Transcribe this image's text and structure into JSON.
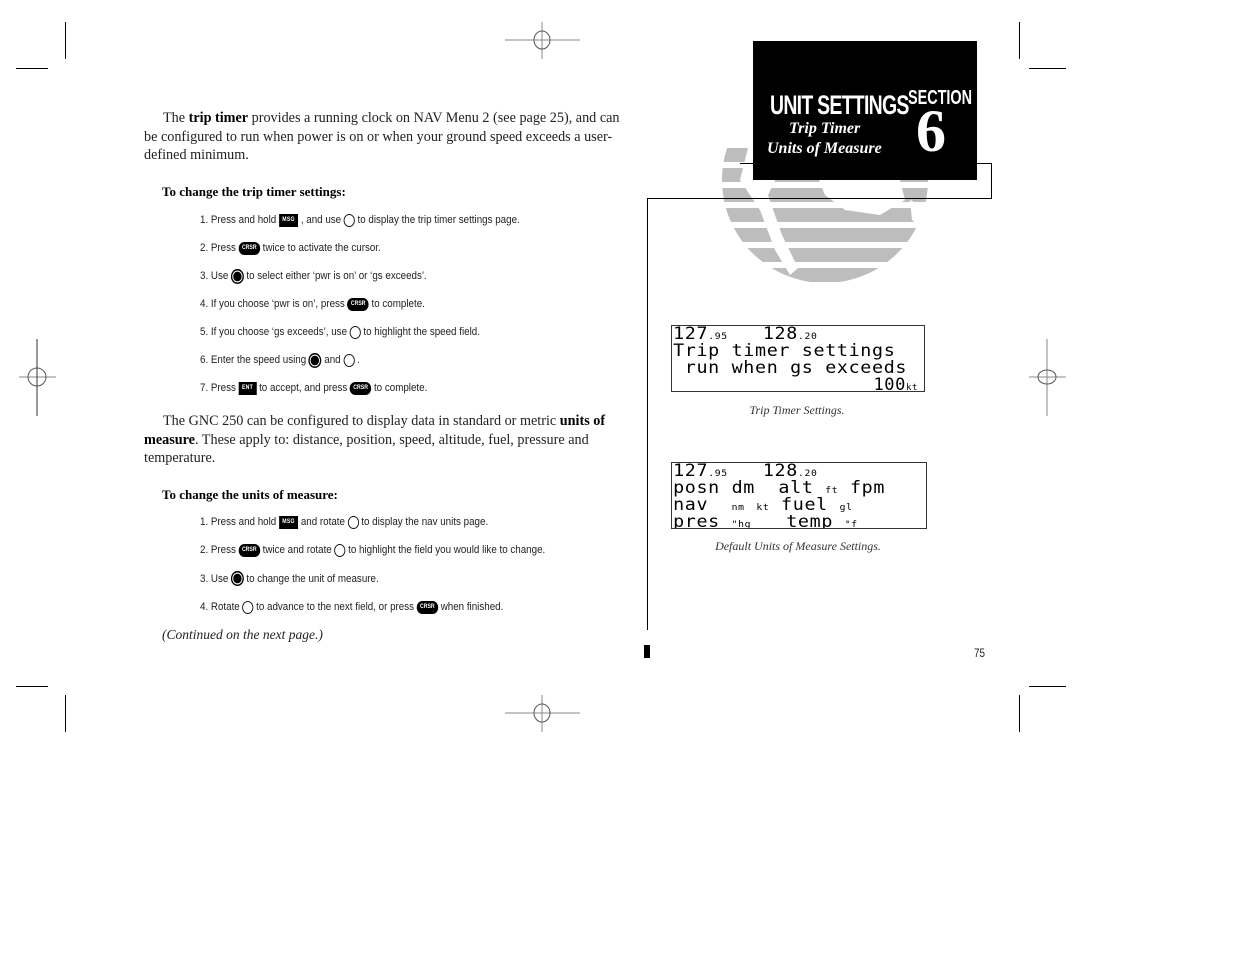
{
  "section": {
    "title": "UNIT SETTINGS",
    "subtitles": [
      "Trip Timer",
      "Units of Measure"
    ],
    "label": "SECTION",
    "number": "6"
  },
  "trip_timer": {
    "intro_pre": "The ",
    "intro_bold": "trip timer",
    "intro_post": " provides a running clock on NAV Menu 2 (see page 25), and can be configured to run when power is on or when your ground speed exceeds a user-defined minimum.",
    "heading": "To change the trip timer settings:",
    "steps": [
      {
        "parts": [
          "1. Press and hold",
          "MSG",
          ", and use",
          "outer-knob",
          "to display the trip timer settings page."
        ]
      },
      {
        "parts": [
          "2. Press",
          "CRSR",
          "twice to activate the cursor."
        ]
      },
      {
        "parts": [
          "3. Use",
          "inner-knob",
          "to select either ‘pwr is on’ or ‘gs exceeds’."
        ]
      },
      {
        "parts": [
          "4. If you choose ‘pwr is on’, press",
          "CRSR",
          "to complete."
        ]
      },
      {
        "parts": [
          "5. If you choose ‘gs exceeds’, use",
          "outer-knob",
          "to highlight the speed field."
        ]
      },
      {
        "parts": [
          "6. Enter the speed using",
          "inner-knob",
          "and",
          "outer-knob",
          "."
        ]
      },
      {
        "parts": [
          "7. Press",
          "ENT",
          "to accept, and press",
          "CRSR",
          "to complete."
        ]
      }
    ]
  },
  "units": {
    "intro_pre": "The GNC 250 can be configured to display data in standard or metric ",
    "intro_bold": "units of measure",
    "intro_post": ". These apply to: distance, position, speed, altitude, fuel, pressure and temperature.",
    "heading": "To change the units of measure:",
    "steps": [
      {
        "parts": [
          "1. Press and hold",
          "MSG",
          "and rotate",
          "outer-knob",
          "to display the nav units page."
        ]
      },
      {
        "parts": [
          "2. Press",
          "CRSR",
          "twice and rotate",
          "outer-knob",
          "to highlight the field you would like to change."
        ]
      },
      {
        "parts": [
          "3. Use",
          "inner-knob",
          "to change the unit of measure."
        ]
      },
      {
        "parts": [
          "4. Rotate",
          "outer-knob",
          "to advance to the next field, or press",
          "CRSR",
          "when finished."
        ]
      }
    ],
    "continued": "(Continued on the next page.)"
  },
  "keys": {
    "msg": "MSG",
    "crsr": "CRSR",
    "ent": "ENT"
  },
  "screens": {
    "trip_timer": {
      "freq_active": "127",
      "freq_active_dec": ".95",
      "freq_standby": "128",
      "freq_standby_dec": ".20",
      "line2": "Trip timer settings",
      "line3": " run when gs exceeds",
      "speed_value": "100",
      "speed_unit": "kt",
      "caption": "Trip Timer Settings."
    },
    "units": {
      "freq_active": "127",
      "freq_active_dec": ".95",
      "freq_standby": "128",
      "freq_standby_dec": ".20",
      "posn_label": "posn",
      "posn_value": "dm",
      "alt_label": "alt",
      "alt_unit": "ft",
      "vs_unit": "fpm",
      "nav_label": "nav",
      "nav_dist": "nm",
      "nav_speed": "kt",
      "fuel_label": "fuel",
      "fuel_unit": "gl",
      "pres_label": "pres",
      "pres_unit": "\"hg",
      "temp_label": "temp",
      "temp_unit": "°f",
      "caption": "Default Units of Measure Settings."
    }
  },
  "page_number": "75",
  "colors": {
    "globe_gray": "#bdbdbd",
    "header_bg": "#000000",
    "header_text": "#ffffff"
  }
}
